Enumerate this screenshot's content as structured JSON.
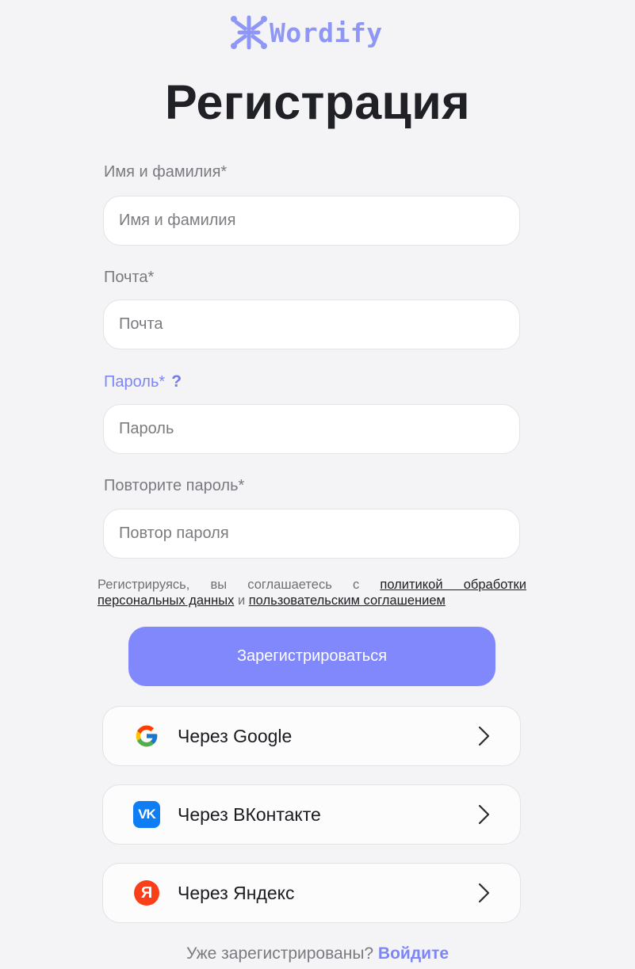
{
  "brand": {
    "name": "Wordify",
    "accent": "#8f97f6"
  },
  "title": "Регистрация",
  "form": {
    "fields": [
      {
        "label": "Имя и фамилия*",
        "placeholder": "Имя и фамилия",
        "value": ""
      },
      {
        "label": "Почта*",
        "placeholder": "Почта",
        "value": ""
      },
      {
        "label": "Пароль*",
        "placeholder": "Пароль",
        "value": "",
        "help_icon": "question-icon",
        "help": "?"
      },
      {
        "label": "Повторите пароль*",
        "placeholder": "Повтор пароля",
        "value": ""
      }
    ]
  },
  "terms": {
    "prefix": "Регистрируясь, вы соглашаетесь с ",
    "policy_link": "политикой обработки персональных данных",
    "conjunction": " и ",
    "agreement_link": "пользовательским соглашением"
  },
  "submit": {
    "label": "Зарегистрироваться",
    "color": "#8088fb"
  },
  "social": [
    {
      "label": "Через Google",
      "icon": "google-icon"
    },
    {
      "label": "Через ВКонтакте",
      "icon": "vk-icon",
      "icon_text": "VK",
      "color": "#0f7ef5"
    },
    {
      "label": "Через Яндекс",
      "icon": "yandex-icon",
      "icon_text": "Я",
      "color": "#fb3e1a"
    }
  ],
  "footer": {
    "text": "Уже зарегистрированы? ",
    "link": "Войдите"
  }
}
